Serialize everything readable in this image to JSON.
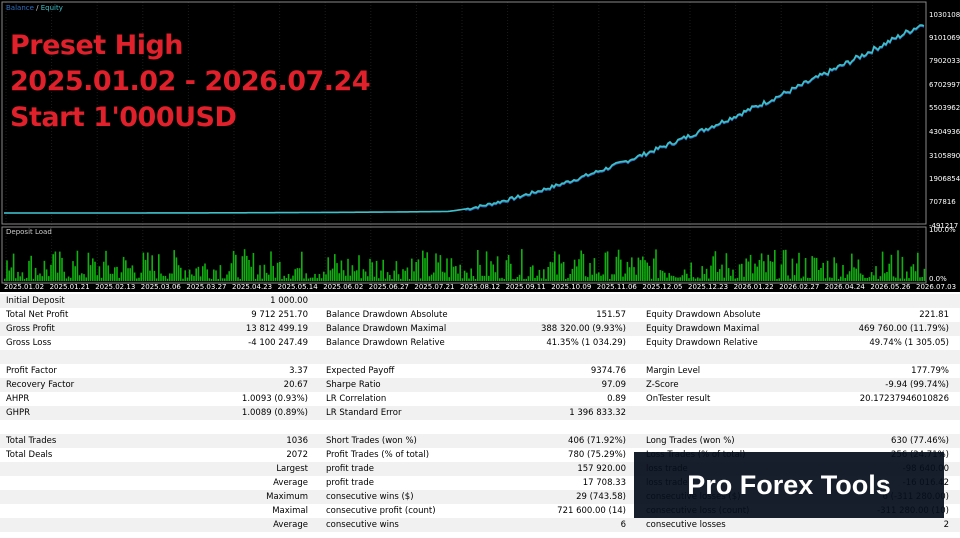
{
  "chart": {
    "legend": {
      "balance": "Balance",
      "sep": " / ",
      "equity": "Equity"
    },
    "colors": {
      "balance": "#2e6fbf",
      "equity": "#3ec1c8",
      "deposit": "#10b010",
      "grid": "#2a2a2a",
      "red": "#e0202a"
    },
    "price_labels": [
      "10301085",
      "9101069",
      "7902033",
      "6702997",
      "5503962",
      "4304936",
      "3105890",
      "1906854",
      "707816",
      "-491217"
    ],
    "deposit_label": "Deposit Load",
    "deposit_scale": [
      "100.0%",
      "0.0%"
    ],
    "date_labels": [
      "2025.01.02",
      "2025.01.21",
      "2025.02.13",
      "2025.03.06",
      "2025.03.27",
      "2025.04.23",
      "2025.05.14",
      "2025.06.02",
      "2025.06.27",
      "2025.07.21",
      "2025.08.12",
      "2025.09.11",
      "2025.10.09",
      "2025.11.06",
      "2025.12.05",
      "2025.12.23",
      "2026.01.22",
      "2026.02.27",
      "2026.04.24",
      "2026.05.26",
      "2026.07.03"
    ]
  },
  "overlay": {
    "line1": "Preset High",
    "line2": "2025.01.02 - 2026.07.24",
    "line3": "Start 1'000USD"
  },
  "stats_rows": [
    {
      "l1": "Initial Deposit",
      "v1": "1 000.00",
      "l2": "",
      "v2": "",
      "l3": "",
      "v3": ""
    },
    {
      "l1": "Total Net Profit",
      "v1": "9 712 251.70",
      "l2": "Balance Drawdown Absolute",
      "v2": "151.57",
      "l3": "Equity Drawdown Absolute",
      "v3": "221.81"
    },
    {
      "l1": "Gross Profit",
      "v1": "13 812 499.19",
      "l2": "Balance Drawdown Maximal",
      "v2": "388 320.00 (9.93%)",
      "l3": "Equity Drawdown Maximal",
      "v3": "469 760.00 (11.79%)"
    },
    {
      "l1": "Gross Loss",
      "v1": "-4 100 247.49",
      "l2": "Balance Drawdown Relative",
      "v2": "41.35% (1 034.29)",
      "l3": "Equity Drawdown Relative",
      "v3": "49.74% (1 305.05)"
    },
    {
      "l1": "",
      "v1": "",
      "l2": "",
      "v2": "",
      "l3": "",
      "v3": ""
    },
    {
      "l1": "Profit Factor",
      "v1": "3.37",
      "l2": "Expected Payoff",
      "v2": "9374.76",
      "l3": "Margin Level",
      "v3": "177.79%"
    },
    {
      "l1": "Recovery Factor",
      "v1": "20.67",
      "l2": "Sharpe Ratio",
      "v2": "97.09",
      "l3": "Z-Score",
      "v3": "-9.94 (99.74%)"
    },
    {
      "l1": "AHPR",
      "v1": "1.0093 (0.93%)",
      "l2": "LR Correlation",
      "v2": "0.89",
      "l3": "OnTester result",
      "v3": "20.17237946010826"
    },
    {
      "l1": "GHPR",
      "v1": "1.0089 (0.89%)",
      "l2": "LR Standard Error",
      "v2": "1 396 833.32",
      "l3": "",
      "v3": ""
    },
    {
      "l1": "",
      "v1": "",
      "l2": "",
      "v2": "",
      "l3": "",
      "v3": ""
    },
    {
      "l1": "Total Trades",
      "v1": "1036",
      "l2": "Short Trades (won %)",
      "v2": "406 (71.92%)",
      "l3": "Long Trades (won %)",
      "v3": "630 (77.46%)"
    },
    {
      "l1": "Total Deals",
      "v1": "2072",
      "l2": "Profit Trades (% of total)",
      "v2": "780 (75.29%)",
      "l3": "Loss Trades (% of total)",
      "v3": "256 (24.71%)"
    },
    {
      "l1": "",
      "v1": "Largest",
      "l2": "profit trade",
      "v2": "157 920.00",
      "l3": "loss trade",
      "v3": "-98 640.00"
    },
    {
      "l1": "",
      "v1": "Average",
      "l2": "profit trade",
      "v2": "17 708.33",
      "l3": "loss trade",
      "v3": "-16 016.42"
    },
    {
      "l1": "",
      "v1": "Maximum",
      "l2": "consecutive wins ($)",
      "v2": "29 (743.58)",
      "l3": "consecutive losses ($)",
      "v3": "6 (-311 280.00)"
    },
    {
      "l1": "",
      "v1": "Maximal",
      "l2": "consecutive profit (count)",
      "v2": "721 600.00 (14)",
      "l3": "consecutive loss (count)",
      "v3": "-311 280.00 (10)"
    },
    {
      "l1": "",
      "v1": "Average",
      "l2": "consecutive wins",
      "v2": "6",
      "l3": "consecutive losses",
      "v3": "2"
    }
  ],
  "brand": {
    "text": "Pro Forex Tools"
  }
}
